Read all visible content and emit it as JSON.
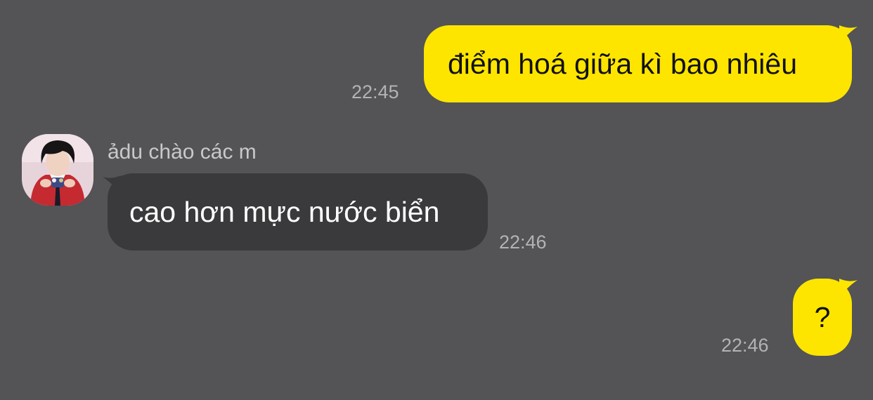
{
  "theme": {
    "background": "#545355",
    "outgoing_bubble": "#FEE500",
    "incoming_bubble": "#3A393B",
    "timestamp_color": "#B3B2B4"
  },
  "messages": [
    {
      "direction": "outgoing",
      "text": "điểm hoá giữa kì bao nhiêu",
      "time": "22:45"
    },
    {
      "direction": "incoming",
      "sender": "ảdu chào các m",
      "avatar": "user-avatar-photo",
      "text": "cao hơn mực nước biển",
      "time": "22:46"
    },
    {
      "direction": "outgoing",
      "text": "?",
      "time": "22:46"
    }
  ]
}
